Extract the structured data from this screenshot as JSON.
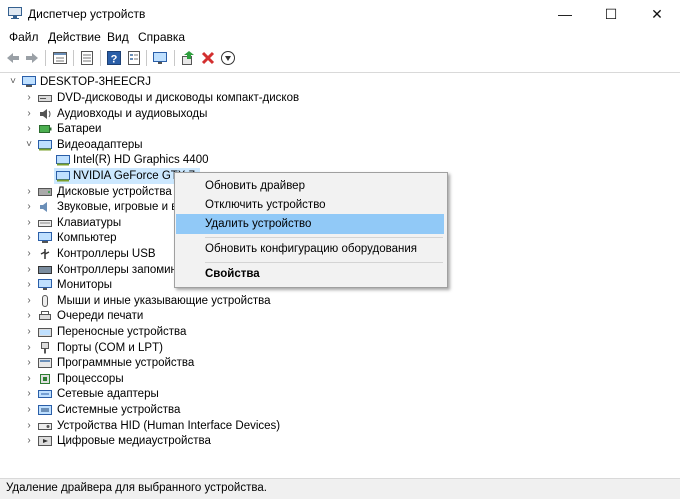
{
  "window": {
    "title": "Диспетчер устройств",
    "minimize": "—",
    "maximize": "☐",
    "close": "✕"
  },
  "menu": [
    "Файл",
    "Действие",
    "Вид",
    "Справка"
  ],
  "toolbar_icons": [
    "back-arrow-icon",
    "forward-arrow-icon",
    "properties-icon",
    "details-view-icon",
    "help-icon",
    "list-view-icon",
    "monitor-icon",
    "update-driver-icon",
    "remove-device-icon",
    "download-icon"
  ],
  "tree": {
    "root": "DESKTOP-3HEECRJ",
    "items": [
      {
        "label": "DVD-дисководы и дисководы компакт-дисков",
        "icon": "dvd-drive-icon"
      },
      {
        "label": "Аудиовходы и аудиовыходы",
        "icon": "speaker-icon"
      },
      {
        "label": "Батареи",
        "icon": "battery-icon"
      },
      {
        "label": "Видеоадаптеры",
        "icon": "display-adapter-icon",
        "expanded": true,
        "children": [
          "Intel(R) HD Graphics 4400",
          "NVIDIA GeForce GTX 7"
        ]
      },
      {
        "label": "Дисковые устройства",
        "icon": "disk-drive-icon"
      },
      {
        "label": "Звуковые, игровые и вид",
        "icon": "sound-icon"
      },
      {
        "label": "Клавиатуры",
        "icon": "keyboard-icon"
      },
      {
        "label": "Компьютер",
        "icon": "computer-icon"
      },
      {
        "label": "Контроллеры USB",
        "icon": "usb-icon"
      },
      {
        "label": "Контроллеры запомина",
        "icon": "storage-controller-icon"
      },
      {
        "label": "Мониторы",
        "icon": "monitor-icon"
      },
      {
        "label": "Мыши и иные указывающие устройства",
        "icon": "mouse-icon"
      },
      {
        "label": "Очереди печати",
        "icon": "printer-icon"
      },
      {
        "label": "Переносные устройства",
        "icon": "portable-device-icon"
      },
      {
        "label": "Порты (COM и LPT)",
        "icon": "port-icon"
      },
      {
        "label": "Программные устройства",
        "icon": "software-device-icon"
      },
      {
        "label": "Процессоры",
        "icon": "processor-icon"
      },
      {
        "label": "Сетевые адаптеры",
        "icon": "network-adapter-icon"
      },
      {
        "label": "Системные устройства",
        "icon": "system-device-icon"
      },
      {
        "label": "Устройства HID (Human Interface Devices)",
        "icon": "hid-icon"
      },
      {
        "label": "Цифровые медиаустройства",
        "icon": "media-device-icon"
      }
    ]
  },
  "context_menu": {
    "items": [
      {
        "label": "Обновить драйвер"
      },
      {
        "label": "Отключить устройство"
      },
      {
        "label": "Удалить устройство",
        "highlighted": true
      },
      {
        "label": "Обновить конфигурацию оборудования"
      },
      {
        "label": "Свойства",
        "bold": true
      }
    ]
  },
  "status_bar": "Удаление драйвера для выбранного устройства.",
  "colors": {
    "selection": "#cce8ff",
    "menu_highlight": "#91c9f7",
    "remove_red": "#d32f2f"
  }
}
